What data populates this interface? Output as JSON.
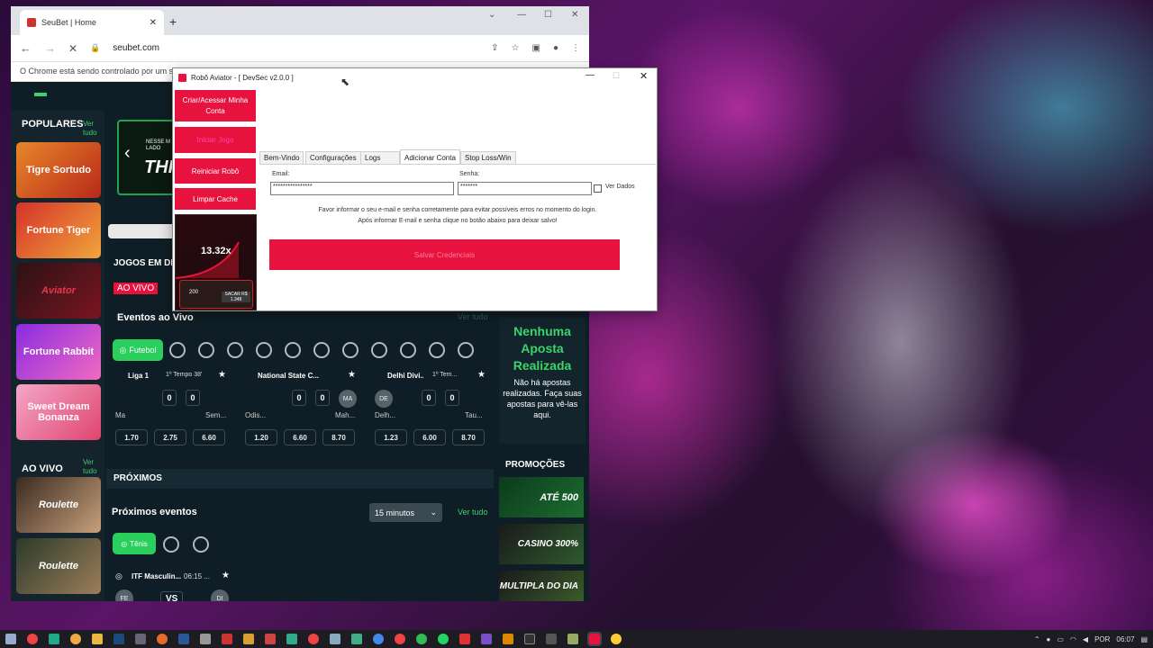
{
  "browser": {
    "tab_title": "SeuBet | Home",
    "url": "seubet.com",
    "automation_notice": "O Chrome está sendo controlado por um so"
  },
  "site": {
    "sidebar": {
      "populares_label": "POPULARES",
      "populares_link": "Ver tudo",
      "games": [
        "Tigre Sortudo",
        "Fortune Tiger",
        "Aviator",
        "Fortune Rabbit",
        "Sweet Dream Bonanza"
      ],
      "ao_vivo_label": "AO VIVO",
      "ao_vivo_link": "Ver tudo",
      "live_games": [
        "Roulette",
        "Roulette"
      ]
    },
    "banner_text": "THR",
    "banner_small": "NESSE M LADO",
    "jogos_label": "JOGOS EM DE",
    "ao_vivo_badge": "AO VIVO",
    "eventos_title": "Eventos ao Vivo",
    "eventos_link": "Ver tudo",
    "sport_chip": "Futebol",
    "matches": [
      {
        "league": "Liga 1",
        "time": "1º Tempo 38'",
        "score1": "0",
        "score2": "0",
        "home": "Ma",
        "away": "Sem...",
        "odds": [
          "1.70",
          "2.75",
          "6.60"
        ]
      },
      {
        "league": "National State C...",
        "time": "",
        "score1": "0",
        "score2": "0",
        "home": "Odis...",
        "away": "Mah...",
        "away_badge": "MA",
        "odds": [
          "1.20",
          "6.60",
          "8.70"
        ]
      },
      {
        "league": "Delhi Divi...",
        "time": "1º Tem...",
        "score1": "0",
        "score2": "0",
        "home": "Delh...",
        "home_badge": "DE",
        "away": "Tau...",
        "odds": [
          "1.23",
          "6.00",
          "8.70"
        ]
      }
    ],
    "proximos_title": "PRÓXIMOS",
    "proximos_eventos": "Próximos eventos",
    "time_select": "15 minutos",
    "proximos_link": "Ver tudo",
    "tenis_chip": "Tênis",
    "next_match": {
      "league": "ITF Masculin...",
      "time": "06:15 ...",
      "home_badge": "FE",
      "vs": "VS",
      "away_badge": "DI"
    },
    "betslip": {
      "title": "Nenhuma Aposta Realizada",
      "text": "Não há apostas realizadas. Faça suas apostas para vê-las aqui."
    },
    "promocoes_title": "PROMOÇÕES",
    "promos": [
      "ATÉ 500",
      "CASINO 300%",
      "MULTIPLA DO DIA"
    ]
  },
  "dialog": {
    "title": "Robô Aviator - [ DevSec v2.0.0 ]",
    "buttons": [
      "Criar/Acessar Minha Conta",
      "Iniciar Jogo",
      "Reiniciar Robô",
      "Limpar Cache"
    ],
    "preview_multiplier": "13.32x",
    "preview_bet": "200",
    "preview_cashout": "SACAR R$ 1.348",
    "tabs": [
      "Bem-Vindo",
      "Configurações",
      "Logs",
      "Adicionar Conta",
      "Stop Loss/Win"
    ],
    "active_tab": "Adicionar Conta",
    "email_label": "Email:",
    "email_value": "****************",
    "senha_label": "Senha:",
    "senha_value": "*******",
    "ver_dados_label": "Ver Dados",
    "info_line1": "Favor informar o seu e-mail e senha corretamente para evitar possíveis erros no momento do login.",
    "info_line2": "Após informar E-mail e senha clique no botão abaixo para deixar salvo!",
    "save_button": "Salvar Credenciais"
  },
  "taskbar": {
    "lang": "POR",
    "clock": "06:07"
  },
  "colors": {
    "brand_red": "#e8123f",
    "accent_green": "#3ad46a",
    "site_bg": "#0f1e26"
  }
}
